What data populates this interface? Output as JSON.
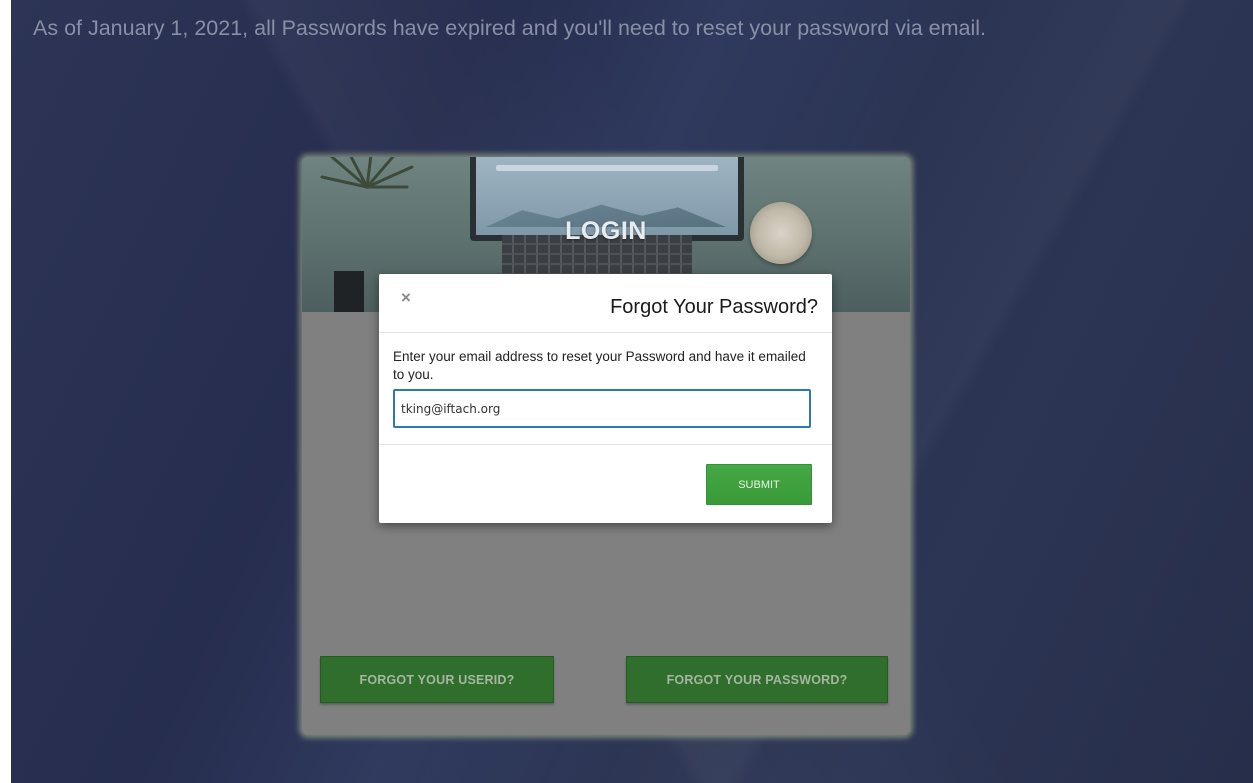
{
  "notice": {
    "text": "As of January 1, 2021, all Passwords have expired and you'll need to reset your password via email."
  },
  "login_card": {
    "hero_title": "LOGIN",
    "forgot_userid_label": "FORGOT YOUR USERID?",
    "forgot_password_label": "FORGOT YOUR PASSWORD?"
  },
  "modal": {
    "close_glyph": "×",
    "title": "Forgot Your Password?",
    "instructions": "Enter your email address to reset your Password and have it emailed to you.",
    "email_value": "tking@iftach.org",
    "submit_label": "SUBMIT"
  },
  "colors": {
    "page_background": "#2a3152",
    "card_background": "#808080",
    "card_button_green": "#2f6f2b",
    "submit_green": "#3ea23d",
    "input_focus_border": "#2b79b5"
  }
}
